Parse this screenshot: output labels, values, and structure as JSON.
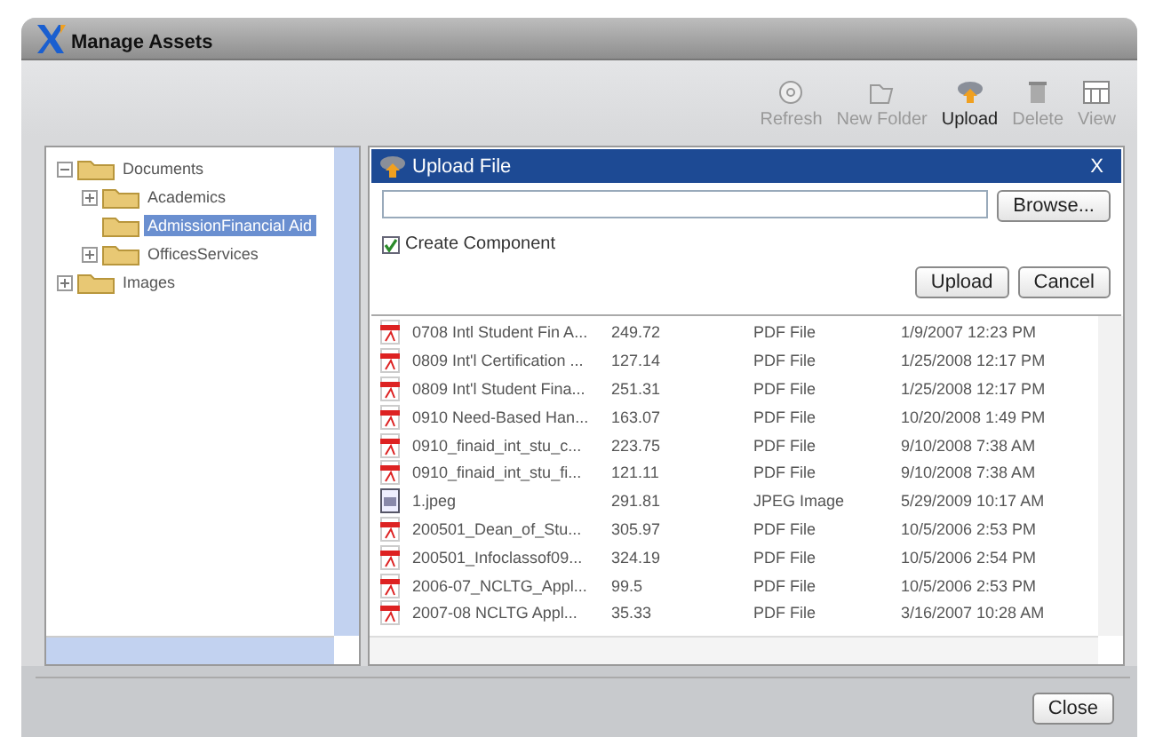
{
  "window": {
    "title": "Manage Assets"
  },
  "toolbar": [
    {
      "label": "Refresh",
      "kind": "refresh",
      "disabled": true
    },
    {
      "label": "New Folder",
      "kind": "folder",
      "disabled": true
    },
    {
      "label": "Upload",
      "kind": "upload",
      "disabled": false
    },
    {
      "label": "Delete",
      "kind": "delete",
      "disabled": true
    },
    {
      "label": "View",
      "kind": "view",
      "disabled": true
    }
  ],
  "tree": [
    {
      "label": "Documents",
      "expanded": true,
      "selected": false,
      "children": [
        {
          "label": "Academics",
          "expanded": false,
          "selected": false
        },
        {
          "label": "AdmissionFinancial Aid",
          "selected": true
        },
        {
          "label": "OfficesServices",
          "expanded": false,
          "selected": false
        }
      ]
    },
    {
      "label": "Images",
      "expanded": false,
      "selected": false
    }
  ],
  "upload_dialog": {
    "title": "Upload File",
    "close": "X",
    "browse": "Browse...",
    "create_component": {
      "label": "Create Component",
      "checked": true
    },
    "buttons": [
      "Upload",
      "Cancel"
    ]
  },
  "files": [
    {
      "name": "0708 Intl Student Fin A...",
      "size": "249.72",
      "type": "PDF File",
      "kind": "pdf",
      "modified": "1/9/2007 12:23 PM"
    },
    {
      "name": "0809 Int'l Certification ...",
      "size": "127.14",
      "type": "PDF File",
      "kind": "pdf",
      "modified": "1/25/2008 12:17 PM"
    },
    {
      "name": "0809 Int'l Student Fina...",
      "size": "251.31",
      "type": "PDF File",
      "kind": "pdf",
      "modified": "1/25/2008 12:17 PM"
    },
    {
      "name": "0910 Need-Based Han...",
      "size": "163.07",
      "type": "PDF File",
      "kind": "pdf",
      "modified": "10/20/2008 1:49 PM"
    },
    {
      "name": "0910_finaid_int_stu_c...",
      "size": "223.75",
      "type": "PDF File",
      "kind": "pdf",
      "modified": "9/10/2008 7:38 AM"
    },
    {
      "name": "0910_finaid_int_stu_fi...",
      "size": "121.11",
      "type": "PDF File",
      "kind": "pdf",
      "modified": "9/10/2008 7:38 AM"
    },
    {
      "name": "1.jpeg",
      "size": "291.81",
      "type": "JPEG Image",
      "kind": "image",
      "modified": "5/29/2009 10:17 AM"
    },
    {
      "name": "200501_Dean_of_Stu...",
      "size": "305.97",
      "type": "PDF File",
      "kind": "pdf",
      "modified": "10/5/2006 2:53 PM"
    },
    {
      "name": "200501_Infoclassof09...",
      "size": "324.19",
      "type": "PDF File",
      "kind": "pdf",
      "modified": "10/5/2006 2:54 PM"
    },
    {
      "name": "2006-07_NCLTG_Appl...",
      "size": "99.5",
      "type": "PDF File",
      "kind": "pdf",
      "modified": "10/5/2006 2:53 PM"
    },
    {
      "name": "2007-08 NCLTG Appl...",
      "size": "35.33",
      "type": "PDF File",
      "kind": "pdf",
      "modified": "3/16/2007 10:28 AM"
    }
  ],
  "footer": {
    "close": "Close"
  }
}
